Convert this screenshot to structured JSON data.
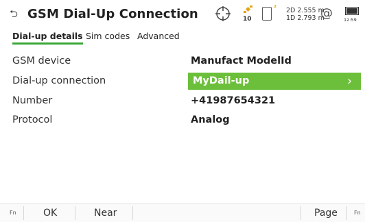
{
  "header": {
    "back_icon": "back-arrow-icon",
    "title": "GSM Dial-Up Connection",
    "status": {
      "satellites": "10",
      "phone_mark": "²",
      "precision_2d": "2D 2.555 m",
      "precision_1d": "1D 2.793 m",
      "at_symbol": "@",
      "clock": "12:59"
    }
  },
  "tabs": [
    {
      "label": "Dial-up details",
      "active": true
    },
    {
      "label": "Sim codes",
      "active": false
    },
    {
      "label": "Advanced",
      "active": false
    }
  ],
  "rows": [
    {
      "label": "GSM device",
      "value": "Manufact ModelId"
    },
    {
      "label": "Dial-up connection",
      "value": "MyDail-up",
      "selected": true
    },
    {
      "label": "Number",
      "value": "+41987654321"
    },
    {
      "label": "Protocol",
      "value": "Analog"
    }
  ],
  "softkeys": {
    "fn_left": "Fn",
    "ok": "OK",
    "near": "Near",
    "page": "Page",
    "fn_right": "Fn"
  },
  "colors": {
    "accent_green": "#6cbf3a",
    "tab_underline": "#3aa635",
    "satellite_orange": "#e7a316"
  }
}
